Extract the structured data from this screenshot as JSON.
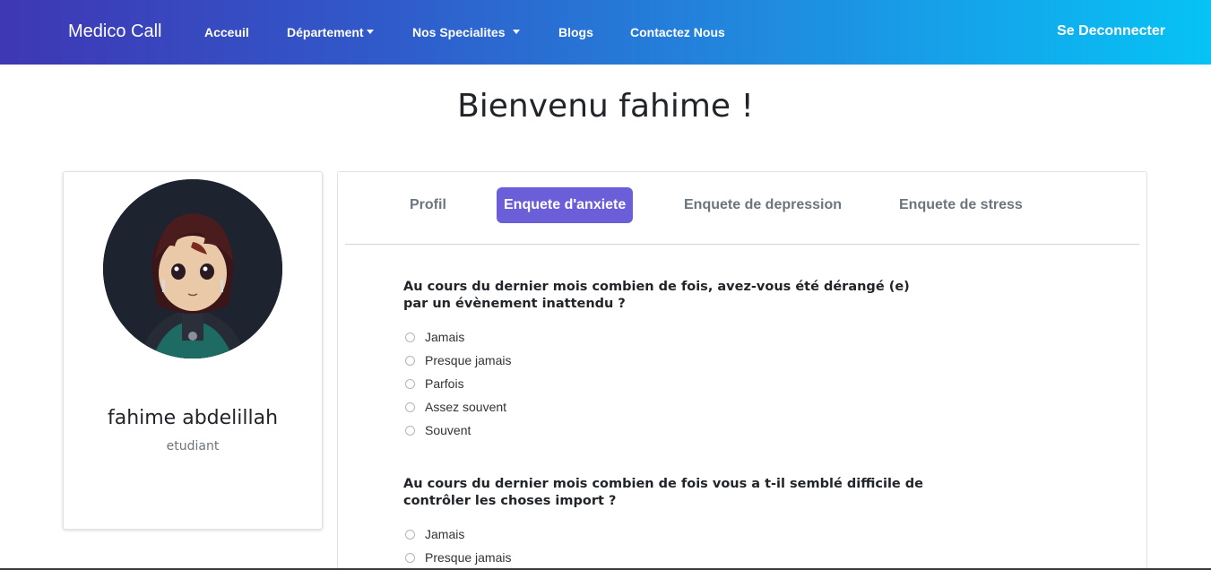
{
  "navbar": {
    "brand": "Medico Call",
    "links": [
      "Acceuil",
      "Département",
      "Nos Specialites",
      "Blogs",
      "Contactez Nous"
    ],
    "logout": "Se Deconnecter"
  },
  "welcome": "Bienvenu fahime !",
  "profile": {
    "name": "fahime abdelillah",
    "role": "etudiant"
  },
  "tabs": [
    "Profil",
    "Enquete d'anxiete",
    "Enquete de depression",
    "Enquete de stress"
  ],
  "active_tab": "Enquete d'anxiete",
  "questions": [
    {
      "text": "Au cours du dernier mois combien de fois, avez-vous été dérangé (e) par un évènement inattendu ?",
      "options": [
        "Jamais",
        "Presque jamais",
        "Parfois",
        "Assez souvent",
        "Souvent"
      ]
    },
    {
      "text": "Au cours du dernier mois combien de fois vous a t-il semblé difficile de contrôler les choses import ?",
      "options": [
        "Jamais",
        "Presque jamais"
      ]
    }
  ],
  "colors": {
    "nav_gradient_start": "#3f37b4",
    "nav_gradient_end": "#06c3f5",
    "active_tab": "#6a5fd8"
  }
}
